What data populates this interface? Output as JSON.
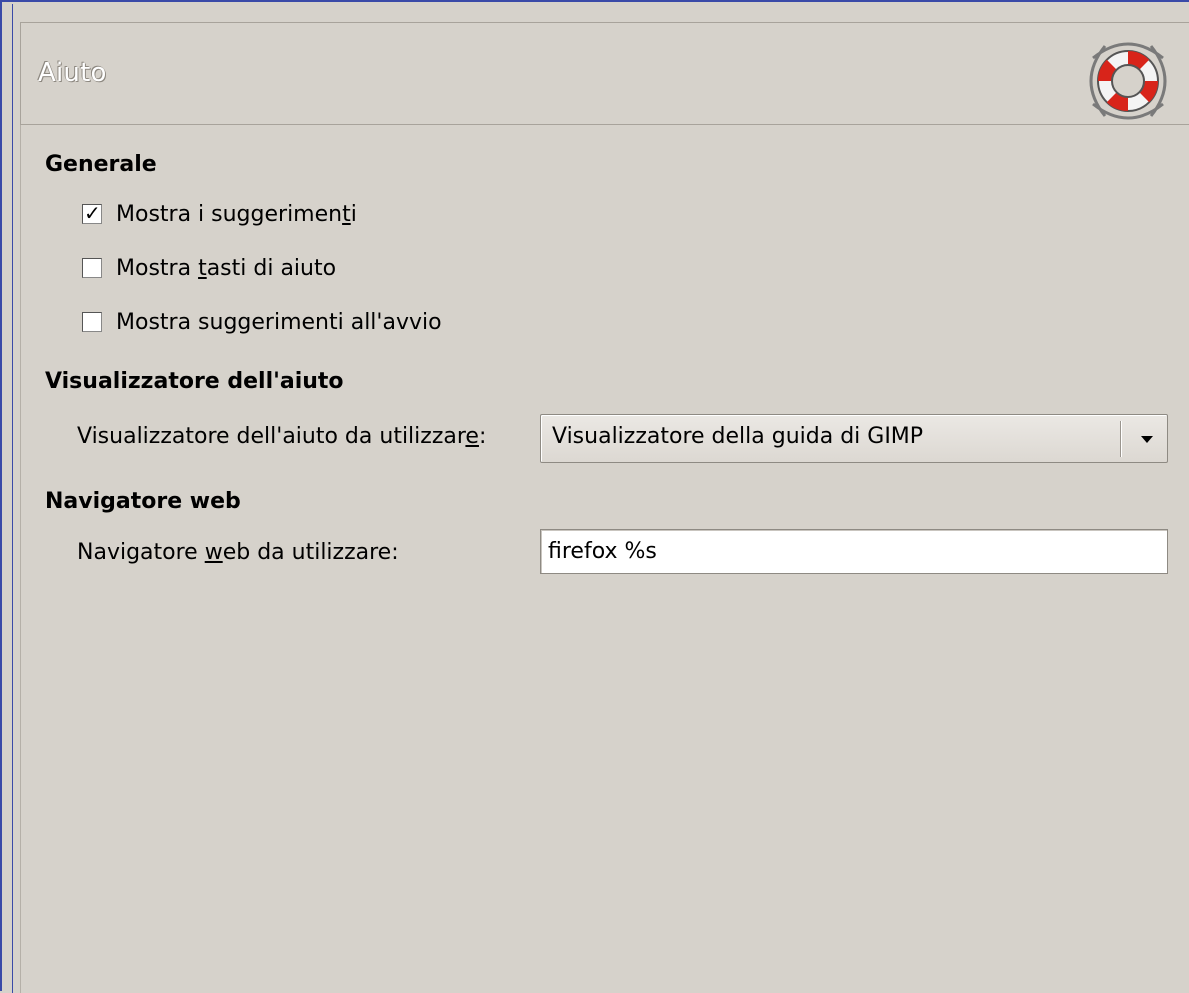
{
  "header": {
    "title": "Aiuto",
    "icon": "lifebuoy-icon"
  },
  "sections": {
    "general": {
      "title": "Generale",
      "show_tips": {
        "label_before": "Mostra i suggerimen",
        "mnemonic": "t",
        "label_after": "i",
        "checked": true
      },
      "show_help_buttons": {
        "label_before": "Mostra ",
        "mnemonic": "t",
        "label_after": "asti di aiuto",
        "checked": false
      },
      "show_tips_startup": {
        "label": "Mostra suggerimenti all'avvio",
        "checked": false
      }
    },
    "help_browser": {
      "title": "Visualizzatore dell'aiuto",
      "field_label_before": "Visualizzatore dell'aiuto da utilizzar",
      "field_mnemonic": "e",
      "field_label_after": ":",
      "selected_value": "Visualizzatore della guida di GIMP"
    },
    "web_browser": {
      "title": "Navigatore web",
      "field_label_before": "Navigatore ",
      "field_mnemonic": "w",
      "field_label_after": "eb da utilizzare:",
      "value": "firefox %s"
    }
  },
  "colors": {
    "background": "#d6d2cb",
    "window_border": "#3a4aa8",
    "icon_red": "#d8241a"
  }
}
